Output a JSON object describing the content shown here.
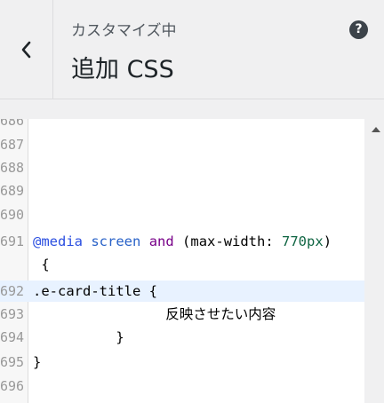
{
  "header": {
    "subtitle": "カスタマイズ中",
    "title": "追加 CSS",
    "help": "?"
  },
  "editor": {
    "line_numbers": [
      "686",
      "687",
      "688",
      "689",
      "690",
      "691",
      "",
      "692",
      "693",
      "694",
      "695",
      "696"
    ],
    "lines": [
      {
        "text": ""
      },
      {
        "text": ""
      },
      {
        "text": ""
      },
      {
        "text": ""
      },
      {
        "text": ""
      },
      {
        "at": "@media",
        "kw": "screen",
        "and": "and",
        "pre": "(max-width: ",
        "num": "770px",
        "post": ")"
      },
      {
        "text": " {"
      },
      {
        "text": ".e-card-title {"
      },
      {
        "text": "                反映させたい内容"
      },
      {
        "text": "          }"
      },
      {
        "text": "}"
      },
      {
        "text": ""
      }
    ]
  }
}
